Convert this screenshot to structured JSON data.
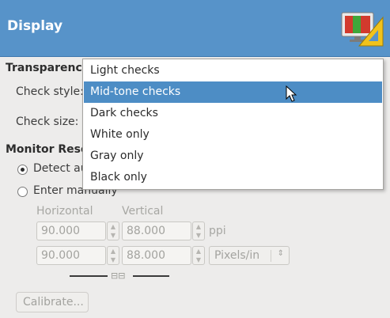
{
  "header": {
    "title": "Display",
    "icon": "display-settings-icon"
  },
  "transparency": {
    "title": "Transparency",
    "check_style_label": "Check style:",
    "check_size_label": "Check size:",
    "options": [
      "Light checks",
      "Mid-tone checks",
      "Dark checks",
      "White only",
      "Gray only",
      "Black only"
    ],
    "selected": "Mid-tone checks"
  },
  "monitor": {
    "title": "Monitor Reso",
    "detect_label": "Detect au",
    "enter_label": "Enter manually",
    "selected": "detect",
    "horizontal_label": "Horizontal",
    "vertical_label": "Vertical",
    "ppi": {
      "horizontal": "90.000",
      "vertical": "88.000",
      "unit": "ppi"
    },
    "pixels": {
      "horizontal": "90.000",
      "vertical": "88.000",
      "unit": "Pixels/in"
    },
    "calibrate_label": "Calibrate..."
  },
  "colors": {
    "header": "#5793c9",
    "selection": "#4d8dc5",
    "background": "#edeceb"
  }
}
